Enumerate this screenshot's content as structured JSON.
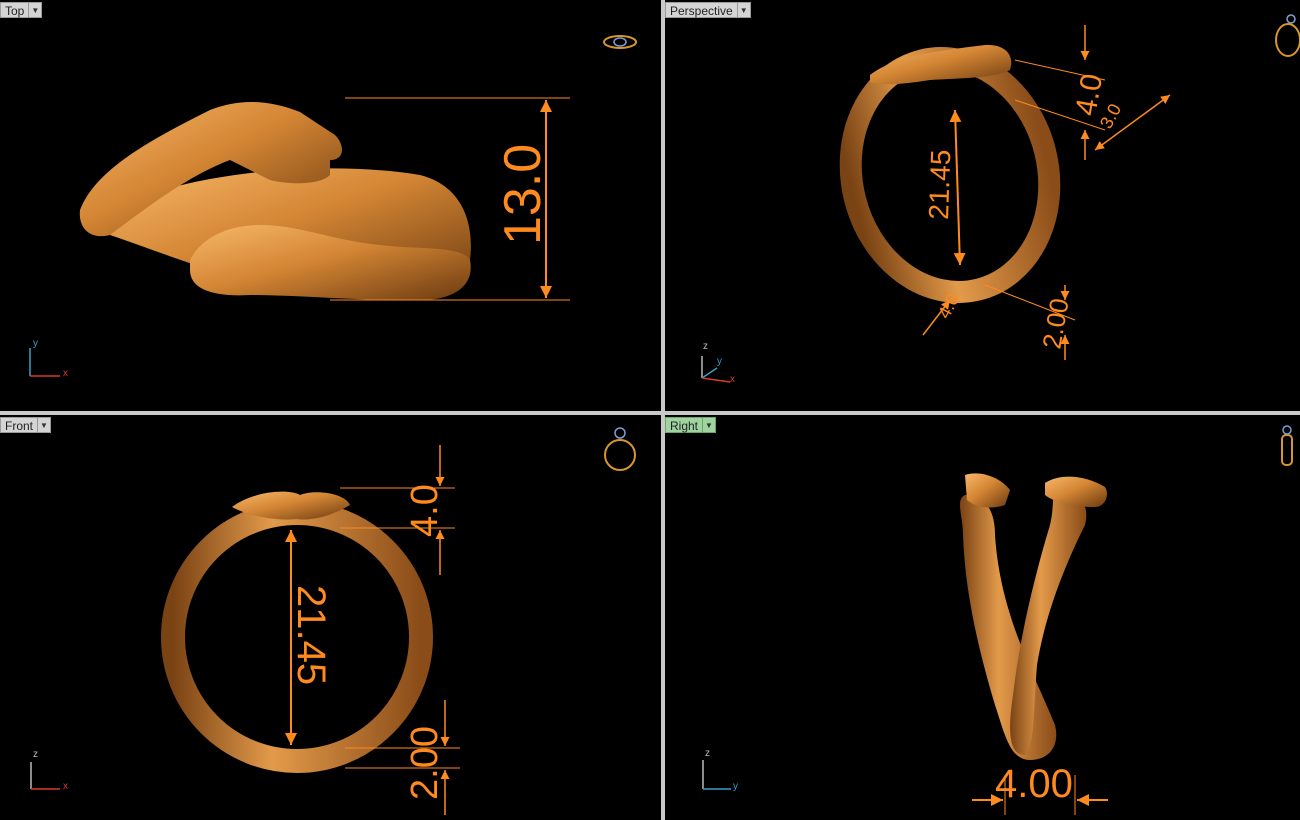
{
  "viewports": {
    "top": {
      "label": "Top",
      "dims": {
        "height": "13.0"
      },
      "axes": {
        "v": "y",
        "h": "x"
      }
    },
    "perspective": {
      "label": "Perspective",
      "dims": {
        "shank_top": "4.0",
        "width": "3.0",
        "inner": "21.45",
        "width_bottom": "4.0",
        "shank_bottom": "2.00"
      },
      "axes": {
        "v": "z",
        "d": "y",
        "h": "x"
      }
    },
    "front": {
      "label": "Front",
      "dims": {
        "shank_top": "4.0",
        "inner": "21.45",
        "shank_bottom": "2.00"
      },
      "axes": {
        "v": "z",
        "h": "x"
      }
    },
    "right": {
      "label": "Right",
      "dims": {
        "width": "4.00"
      },
      "axes": {
        "v": "z",
        "h": "y"
      }
    }
  },
  "active_viewport": "right",
  "colors": {
    "dimension": "#ff8a1e",
    "ring_gold": "#c8782a",
    "axis_x": "#d83a2a",
    "axis_y": "#3aa0c8",
    "axis_z": "#bbbbbb",
    "background": "#000000"
  },
  "icons": {
    "top": "ring-top-view-icon",
    "perspective": "ring-perspective-icon",
    "front": "ring-front-view-icon",
    "right": "ring-side-view-icon"
  }
}
